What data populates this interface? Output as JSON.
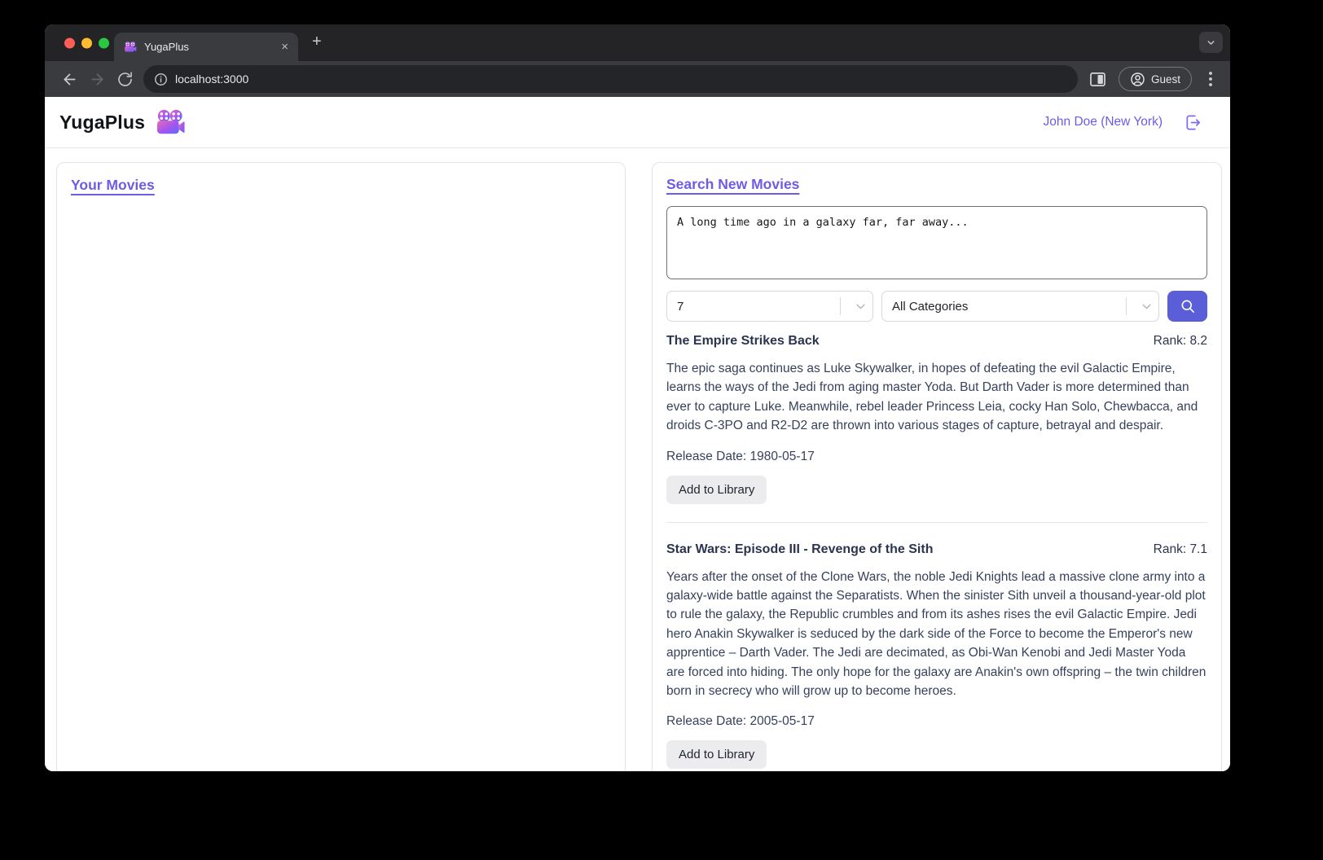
{
  "browser": {
    "tab": {
      "title": "YugaPlus"
    },
    "url": "localhost:3000",
    "guest_label": "Guest",
    "icons": {
      "new_tab": "+",
      "close_tab": "×"
    }
  },
  "header": {
    "app_name": "YugaPlus",
    "user": "John Doe (New York)"
  },
  "library": {
    "title": "Your Movies"
  },
  "search": {
    "title": "Search New Movies",
    "query": "A long time ago in a galaxy far, far away...",
    "limit": "7",
    "category": "All Categories",
    "results": [
      {
        "title": "The Empire Strikes Back",
        "rank": "Rank: 8.2",
        "overview": "The epic saga continues as Luke Skywalker, in hopes of defeating the evil Galactic Empire, learns the ways of the Jedi from aging master Yoda. But Darth Vader is more determined than ever to capture Luke. Meanwhile, rebel leader Princess Leia, cocky Han Solo, Chewbacca, and droids C-3PO and R2-D2 are thrown into various stages of capture, betrayal and despair.",
        "release": "Release Date: 1980-05-17",
        "add_label": "Add to Library"
      },
      {
        "title": "Star Wars: Episode III - Revenge of the Sith",
        "rank": "Rank: 7.1",
        "overview": "Years after the onset of the Clone Wars, the noble Jedi Knights lead a massive clone army into a galaxy-wide battle against the Separatists. When the sinister Sith unveil a thousand-year-old plot to rule the galaxy, the Republic crumbles and from its ashes rises the evil Galactic Empire. Jedi hero Anakin Skywalker is seduced by the dark side of the Force to become the Emperor's new apprentice – Darth Vader. The Jedi are decimated, as Obi-Wan Kenobi and Jedi Master Yoda are forced into hiding. The only hope for the galaxy are Anakin's own offspring – the twin children born in secrecy who will grow up to become heroes.",
        "release": "Release Date: 2005-05-17",
        "add_label": "Add to Library"
      }
    ]
  },
  "colors": {
    "accent_purple": "#6c5ce7",
    "search_button": "#5a5fd8",
    "text_slate": "#2b3550"
  }
}
